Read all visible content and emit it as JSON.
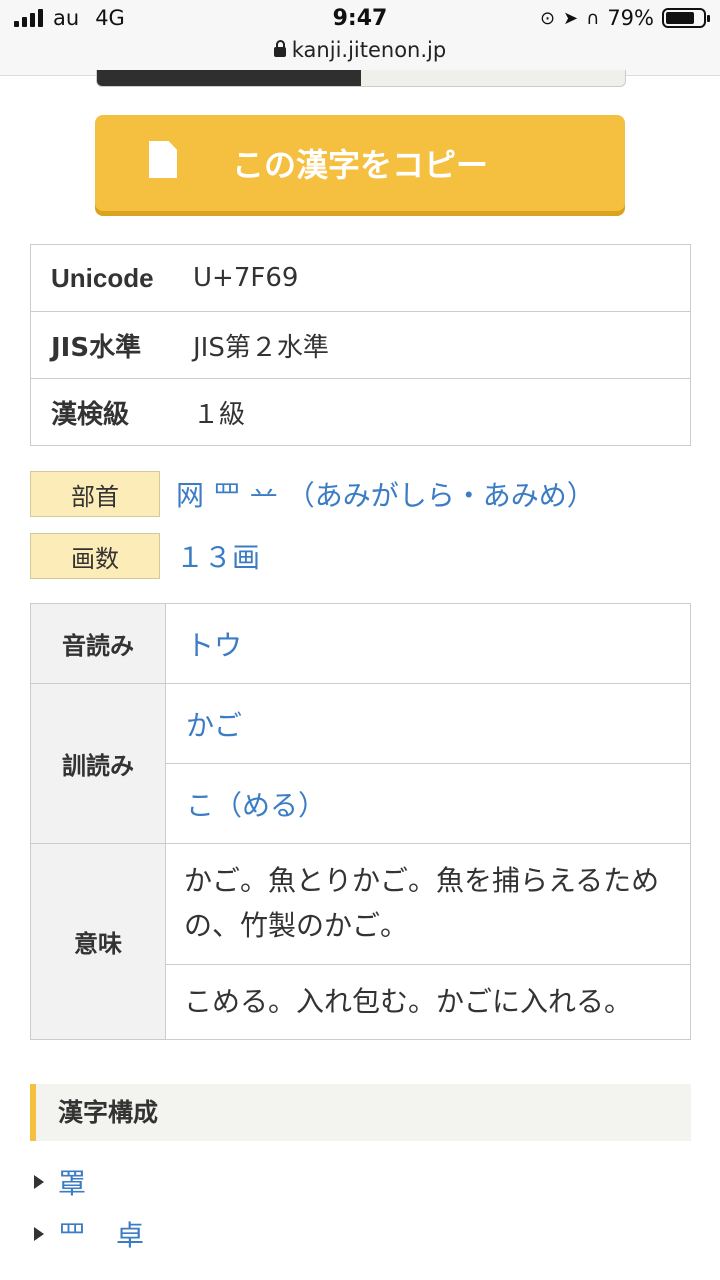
{
  "status": {
    "carrier": "au",
    "network": "4G",
    "time": "9:47",
    "battery": "79%",
    "url": "kanji.jitenon.jp",
    "battery_level": 0.79
  },
  "progress_fraction": 0.5,
  "copy_button": {
    "label": "この漢字をコピー"
  },
  "info": [
    {
      "key": "Unicode",
      "value": "U+7F69"
    },
    {
      "key": "JIS水準",
      "value": "JIS第２水準"
    },
    {
      "key": "漢検級",
      "value": "１級"
    }
  ],
  "radical": {
    "label": "部首",
    "value": "网 罒 䒑 （あみがしら・あみめ）"
  },
  "strokes": {
    "label": "画数",
    "value": "１３画"
  },
  "readings": {
    "on_label": "音読み",
    "on": "トウ",
    "kun_label": "訓読み",
    "kun": [
      "かご",
      "こ（める）"
    ],
    "meaning_label": "意味",
    "meanings": [
      "かご。魚とりかご。魚を捕らえるための、竹製のかご。",
      "こめる。入れ包む。かごに入れる。"
    ]
  },
  "composition": {
    "heading": "漢字構成",
    "items": [
      [
        "罩"
      ],
      [
        "罒",
        "卓"
      ]
    ]
  },
  "colors": {
    "accent": "#f5bf3f",
    "link": "#3b7cc4",
    "tag_bg": "#fcecb8"
  }
}
